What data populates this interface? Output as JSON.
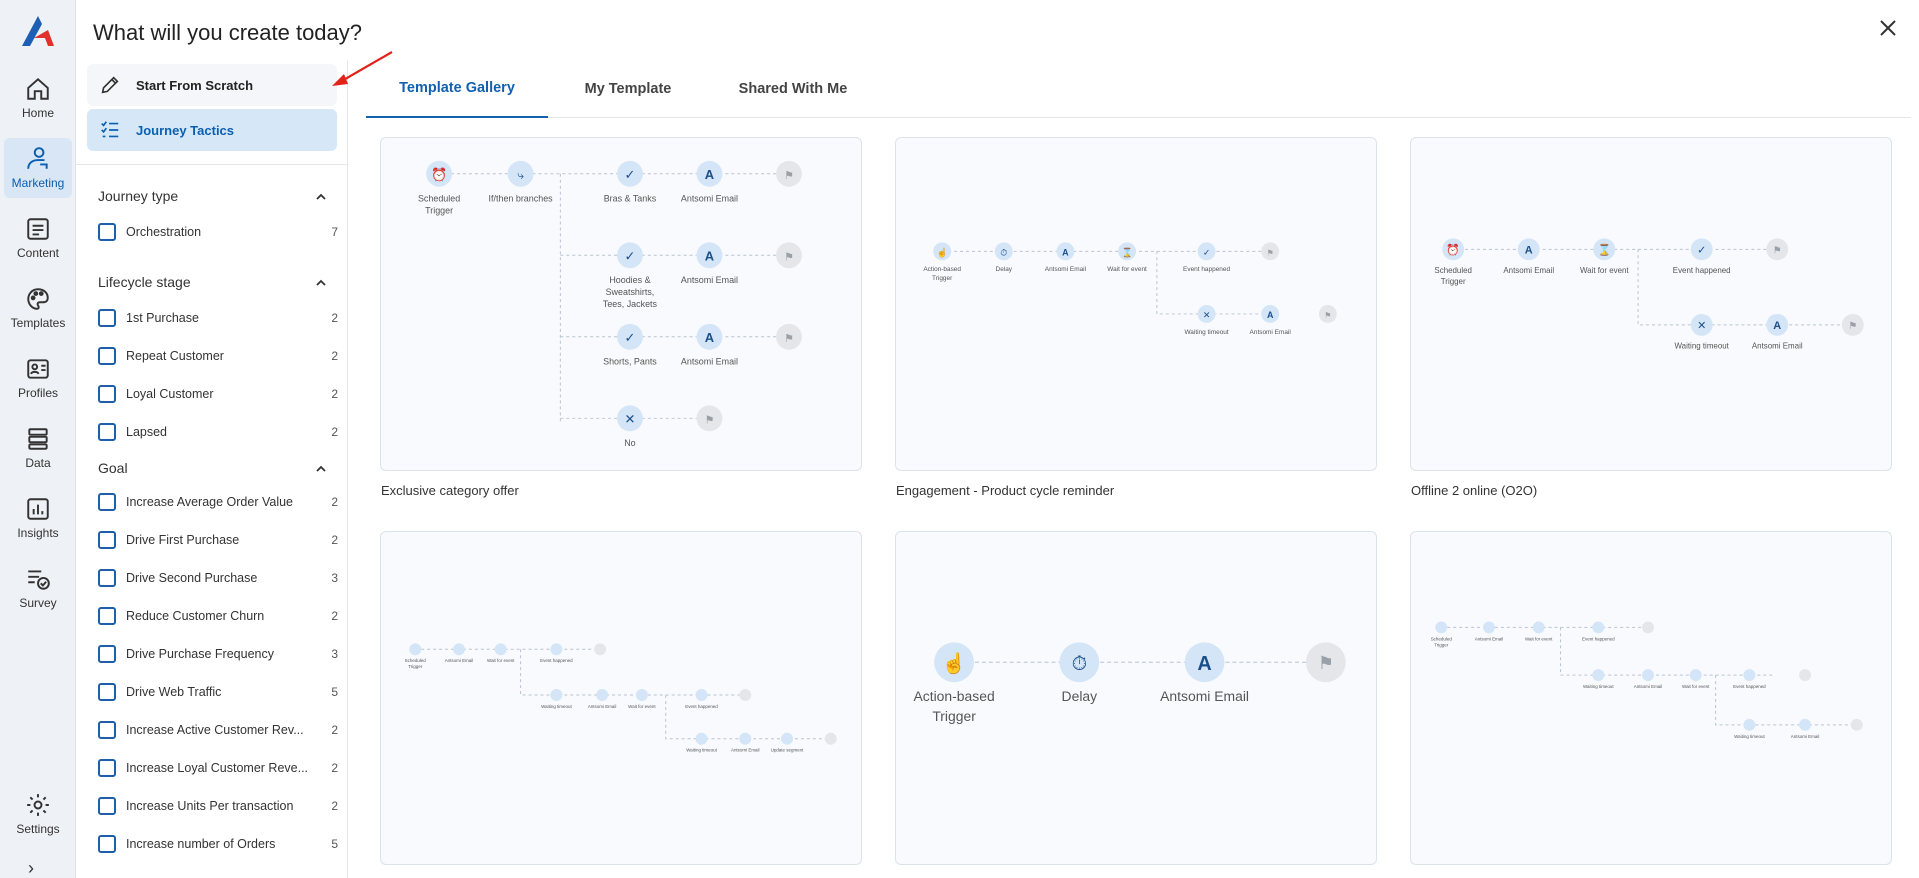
{
  "nav": {
    "items": [
      {
        "label": "Home",
        "icon": "home-icon"
      },
      {
        "label": "Marketing",
        "icon": "marketing-icon"
      },
      {
        "label": "Content",
        "icon": "content-icon"
      },
      {
        "label": "Templates",
        "icon": "palette-icon"
      },
      {
        "label": "Profiles",
        "icon": "profile-card-icon"
      },
      {
        "label": "Data",
        "icon": "database-icon"
      },
      {
        "label": "Insights",
        "icon": "chart-icon"
      },
      {
        "label": "Survey",
        "icon": "survey-icon"
      },
      {
        "label": "Settings",
        "icon": "gear-icon"
      }
    ],
    "active": "Marketing"
  },
  "modal": {
    "title": "What will you create today?",
    "start_from_scratch": "Start From Scratch",
    "journey_tactics": "Journey Tactics"
  },
  "filters": {
    "journey_type": {
      "title": "Journey type",
      "options": [
        {
          "label": "Orchestration",
          "count": "7"
        }
      ]
    },
    "lifecycle": {
      "title": "Lifecycle stage",
      "options": [
        {
          "label": "1st Purchase",
          "count": "2"
        },
        {
          "label": "Repeat Customer",
          "count": "2"
        },
        {
          "label": "Loyal Customer",
          "count": "2"
        },
        {
          "label": "Lapsed",
          "count": "2"
        }
      ]
    },
    "goal": {
      "title": "Goal",
      "options": [
        {
          "label": "Increase Average Order Value",
          "count": "2"
        },
        {
          "label": "Drive First Purchase",
          "count": "2"
        },
        {
          "label": "Drive Second Purchase",
          "count": "3"
        },
        {
          "label": "Reduce Customer Churn",
          "count": "2"
        },
        {
          "label": "Drive Purchase Frequency",
          "count": "3"
        },
        {
          "label": "Drive Web Traffic",
          "count": "5"
        },
        {
          "label": "Increase Active Customer Rev...",
          "count": "2"
        },
        {
          "label": "Increase Loyal Customer Reve...",
          "count": "2"
        },
        {
          "label": "Increase Units Per transaction",
          "count": "2"
        },
        {
          "label": "Increase number of Orders",
          "count": "5"
        }
      ]
    }
  },
  "tabs": [
    "Template Gallery",
    "My Template",
    "Shared With Me"
  ],
  "cards": [
    {
      "title": "Exclusive category offer"
    },
    {
      "title": "Engagement - Product cycle reminder"
    },
    {
      "title": "Offline 2 online (O2O)"
    },
    {
      "title": ""
    },
    {
      "title": ""
    },
    {
      "title": ""
    }
  ],
  "diagram_labels": {
    "scheduled_trigger": [
      "Scheduled",
      "Trigger"
    ],
    "ifthen": "If/then branches",
    "bras": "Bras & Tanks",
    "antsomi_email": "Antsomi Email",
    "hoodies": [
      "Hoodies &",
      "Sweatshirts,",
      "Tees, Jackets"
    ],
    "shorts": "Shorts, Pants",
    "no": "No",
    "action_trigger": [
      "Action-based",
      "Trigger"
    ],
    "delay": "Delay",
    "wait_for_event": "Wait for event",
    "event_happened": "Event happened",
    "waiting_timeout": "Waiting timeout",
    "update_segment": "Update segment"
  },
  "colors": {
    "accent": "#1260b0",
    "node_fill": "#d3e5f7",
    "flag_fill": "#e4e6ea"
  }
}
